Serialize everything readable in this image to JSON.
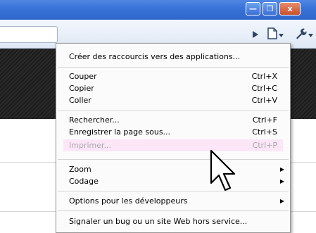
{
  "window": {
    "minimize_glyph": "—",
    "maximize_glyph": "❐",
    "close_glyph": "x"
  },
  "toolbar": {
    "icons": [
      "play-icon",
      "page-icon",
      "chevron-down-icon",
      "wrench-icon"
    ]
  },
  "menu": {
    "items": [
      {
        "label": "Créer des raccourcis vers des applications...",
        "shortcut": ""
      },
      {
        "label": "Couper",
        "shortcut": "Ctrl+X"
      },
      {
        "label": "Copier",
        "shortcut": "Ctrl+C"
      },
      {
        "label": "Coller",
        "shortcut": "Ctrl+V"
      },
      {
        "label": "Rechercher...",
        "shortcut": "Ctrl+F"
      },
      {
        "label": "Enregistrer la page sous...",
        "shortcut": "Ctrl+S"
      },
      {
        "label": "Imprimer...",
        "shortcut": "Ctrl+P",
        "disabled": true
      },
      {
        "label": "Zoom",
        "submenu": true
      },
      {
        "label": "Codage",
        "submenu": true
      },
      {
        "label": "Options pour les développeurs",
        "submenu": true
      },
      {
        "label": "Signaler un bug ou un site Web hors service...",
        "shortcut": ""
      }
    ],
    "submenu_glyph": "▶"
  },
  "colors": {
    "titlebar": "#3a73d8",
    "disabled_highlight": "#fce6f8",
    "menu_background": "#fbfbfb"
  }
}
